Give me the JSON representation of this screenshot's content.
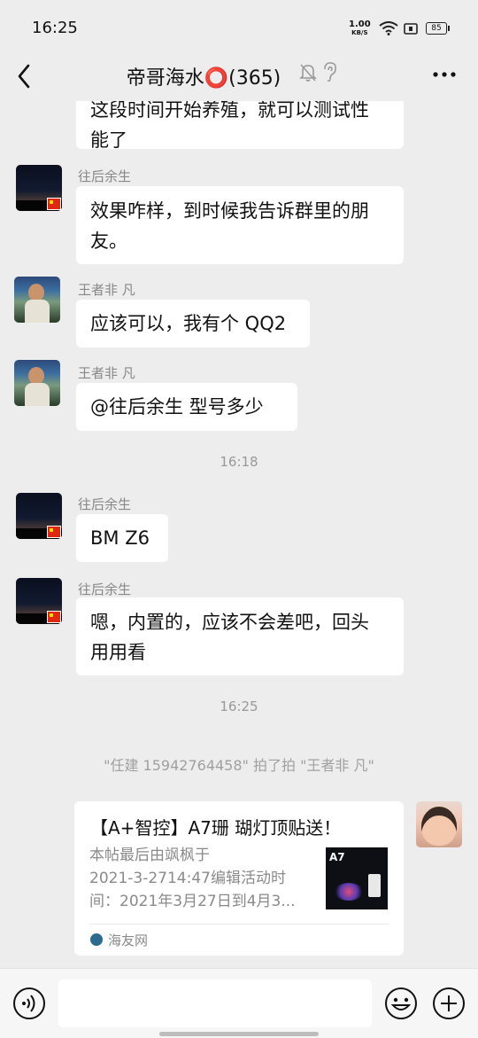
{
  "status_bar": {
    "time": "16:25",
    "net_speed_value": "1.00",
    "net_speed_unit": "KB/S",
    "battery": "85"
  },
  "header": {
    "title": "帝哥海水⭕(365)",
    "icons": [
      "back-arrow-icon",
      "mute-bell-icon",
      "ear-icon",
      "more-dots-icon"
    ]
  },
  "messages": [
    {
      "type": "incoming",
      "sender": "",
      "text_lines": [
        "这段时间开始养殖，就可以测试性",
        "能了"
      ]
    },
    {
      "type": "incoming",
      "sender": "往后余生",
      "text_lines": [
        "效果咋样，到时候我告诉群里的朋",
        "友。"
      ]
    },
    {
      "type": "incoming",
      "sender": "王者非 凡",
      "text_lines": [
        "应该可以，我有个 QQ2"
      ]
    },
    {
      "type": "incoming",
      "sender": "王者非 凡",
      "text_lines": [
        "@往后余生  型号多少"
      ]
    },
    {
      "type": "time",
      "text": "16:18"
    },
    {
      "type": "incoming",
      "sender": "往后余生",
      "text_lines": [
        "BM  Z6"
      ]
    },
    {
      "type": "incoming",
      "sender": "往后余生",
      "text_lines": [
        "嗯，内置的，应该不会差吧，回头",
        "用用看"
      ]
    },
    {
      "type": "time",
      "text": "16:25"
    },
    {
      "type": "system",
      "text": "\"任建 15942764458\" 拍了拍 \"王者非 凡\""
    }
  ],
  "link_card": {
    "title": "【A+智控】A7珊 瑚灯顶贴送！",
    "desc_lines": [
      "本帖最后由飒枫于",
      "2021-3-2714:47编辑活动时",
      "间：2021年3月27日到4月3..."
    ],
    "thumb_label": "A7",
    "source": "海友网"
  },
  "input_bar": {
    "icons": [
      "voice-icon",
      "emoji-icon",
      "plus-icon"
    ]
  },
  "colors": {
    "background": "#ededed",
    "bubble": "#ffffff",
    "name_text": "#888888",
    "flag": "#de2910"
  }
}
